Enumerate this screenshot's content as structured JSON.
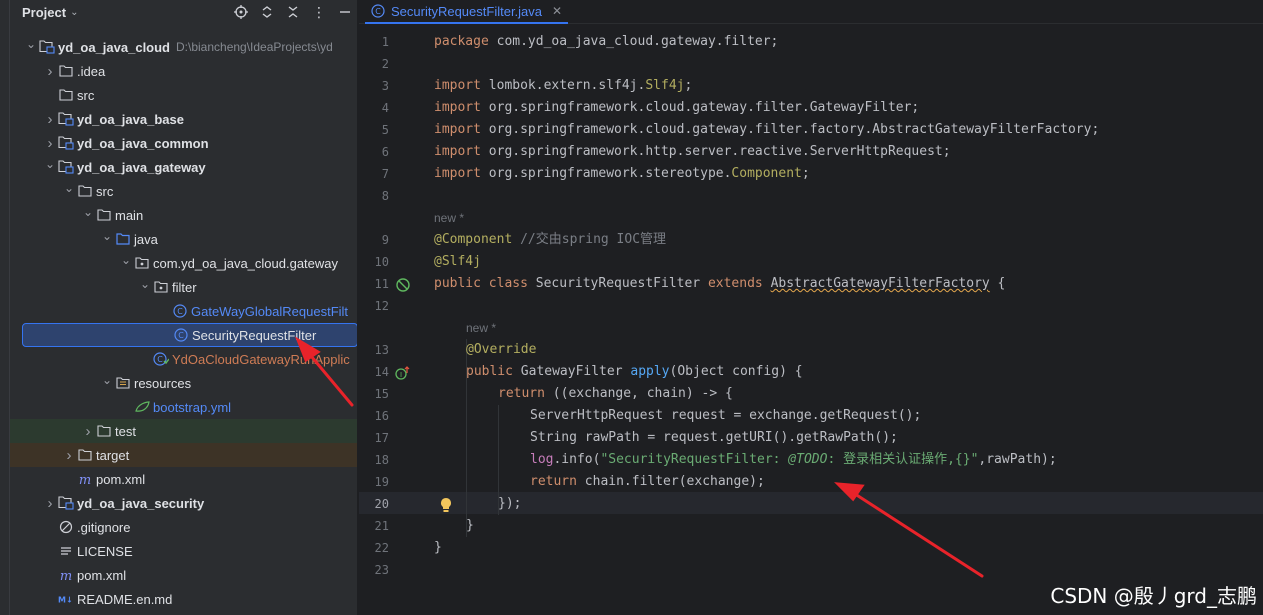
{
  "project_panel": {
    "title": "Project",
    "header_icons": [
      "locate-icon",
      "expand-collapse-icon",
      "collapse-all-icon",
      "more-icon",
      "minimize-icon"
    ],
    "tree": [
      {
        "label": "yd_oa_java_cloud",
        "sub": "D:\\biancheng\\IdeaProjects\\yd",
        "icon": "module-folder-icon",
        "expand": "open"
      },
      {
        "label": ".idea",
        "icon": "folder-icon",
        "expand": "closed"
      },
      {
        "label": "src",
        "icon": "folder-icon",
        "expand": ""
      },
      {
        "label": "yd_oa_java_base",
        "icon": "module-folder-icon",
        "expand": "closed"
      },
      {
        "label": "yd_oa_java_common",
        "icon": "module-folder-icon",
        "expand": "closed"
      },
      {
        "label": "yd_oa_java_gateway",
        "icon": "module-folder-icon",
        "expand": "open"
      },
      {
        "label": "src",
        "icon": "folder-icon",
        "expand": "open"
      },
      {
        "label": "main",
        "icon": "folder-icon",
        "expand": "open"
      },
      {
        "label": "java",
        "icon": "source-folder-icon",
        "expand": "open"
      },
      {
        "label": "com.yd_oa_java_cloud.gateway",
        "icon": "package-icon",
        "expand": "open"
      },
      {
        "label": "filter",
        "icon": "package-icon",
        "expand": "open"
      },
      {
        "label": "GateWayGlobalRequestFilt",
        "icon": "java-class-icon",
        "expand": ""
      },
      {
        "label": "SecurityRequestFilter",
        "icon": "java-class-icon",
        "expand": ""
      },
      {
        "label": "YdOaCloudGatewayRunApplic",
        "icon": "spring-boot-class-icon",
        "expand": ""
      },
      {
        "label": "resources",
        "icon": "resources-folder-icon",
        "expand": "open"
      },
      {
        "label": "bootstrap.yml",
        "icon": "yaml-file-icon",
        "expand": ""
      },
      {
        "label": "test",
        "icon": "folder-icon",
        "expand": "closed"
      },
      {
        "label": "target",
        "icon": "folder-icon",
        "expand": "closed"
      },
      {
        "label": "pom.xml",
        "icon": "maven-icon",
        "expand": ""
      },
      {
        "label": "yd_oa_java_security",
        "icon": "module-folder-icon",
        "expand": "closed"
      },
      {
        "label": ".gitignore",
        "icon": "gitignore-icon",
        "expand": ""
      },
      {
        "label": "LICENSE",
        "icon": "text-file-icon",
        "expand": ""
      },
      {
        "label": "pom.xml",
        "icon": "maven-icon",
        "expand": ""
      },
      {
        "label": "README.en.md",
        "icon": "markdown-icon",
        "expand": ""
      }
    ]
  },
  "editor": {
    "tab_label": "SecurityRequestFilter.java",
    "line_numbers": [
      "1",
      "2",
      "3",
      "4",
      "5",
      "6",
      "7",
      "8",
      "9",
      "10",
      "11",
      "12",
      "13",
      "14",
      "15",
      "16",
      "17",
      "18",
      "19",
      "20",
      "21",
      "22",
      "23"
    ],
    "hints": [
      "new *",
      "new *"
    ],
    "code": {
      "l1_kw": "package",
      "l1_rest": " com.yd_oa_java_cloud.gateway.filter;",
      "import_kw": "import",
      "l3_a": " lombok.extern.slf4j.",
      "l3_b": "Slf4j",
      "l3_c": ";",
      "l4": " org.springframework.cloud.gateway.filter.GatewayFilter;",
      "l5": " org.springframework.cloud.gateway.filter.factory.AbstractGatewayFilterFactory;",
      "l6": " org.springframework.http.server.reactive.ServerHttpRequest;",
      "l7_a": " org.springframework.stereotype.",
      "l7_b": "Component",
      "l7_c": ";",
      "l9_ann": "@Component",
      "l9_cmt": " //交由spring IOC管理",
      "l10_ann": "@Slf4j",
      "l11_public": "public",
      "l11_class": " class",
      "l11_name": " SecurityRequestFilter ",
      "l11_extends": "extends",
      "l11_sp": " ",
      "l11_super": "AbstractGatewayFilterFactory",
      "l11_brace": " {",
      "l13_ann": "@Override",
      "l14_public": "public",
      "l14_type": " GatewayFilter ",
      "l14_fn": "apply",
      "l14_rest": "(Object config) {",
      "l15_return": "return",
      "l15_rest": " ((exchange, chain) -> {",
      "l16": "ServerHttpRequest request = exchange.getRequest();",
      "l17": "String rawPath = request.getURI().getRawPath();",
      "l18_log": "log",
      "l18_info": ".info(",
      "l18_str1": "\"SecurityRequestFilter: ",
      "l18_todo": "@TODO",
      "l18_str2": ": 登录相关认证操作,{}\"",
      "l18_rest": ",rawPath);",
      "l19_return": "return",
      "l19_rest": " chain.filter(exchange);",
      "l20": "});",
      "l21": "}",
      "l22": "}"
    }
  },
  "watermark": "CSDN @殷丿grd_志鹏",
  "colors": {
    "selection": "#2e436e",
    "accent": "#3574f0",
    "annotation_arrow": "#e8232a"
  }
}
